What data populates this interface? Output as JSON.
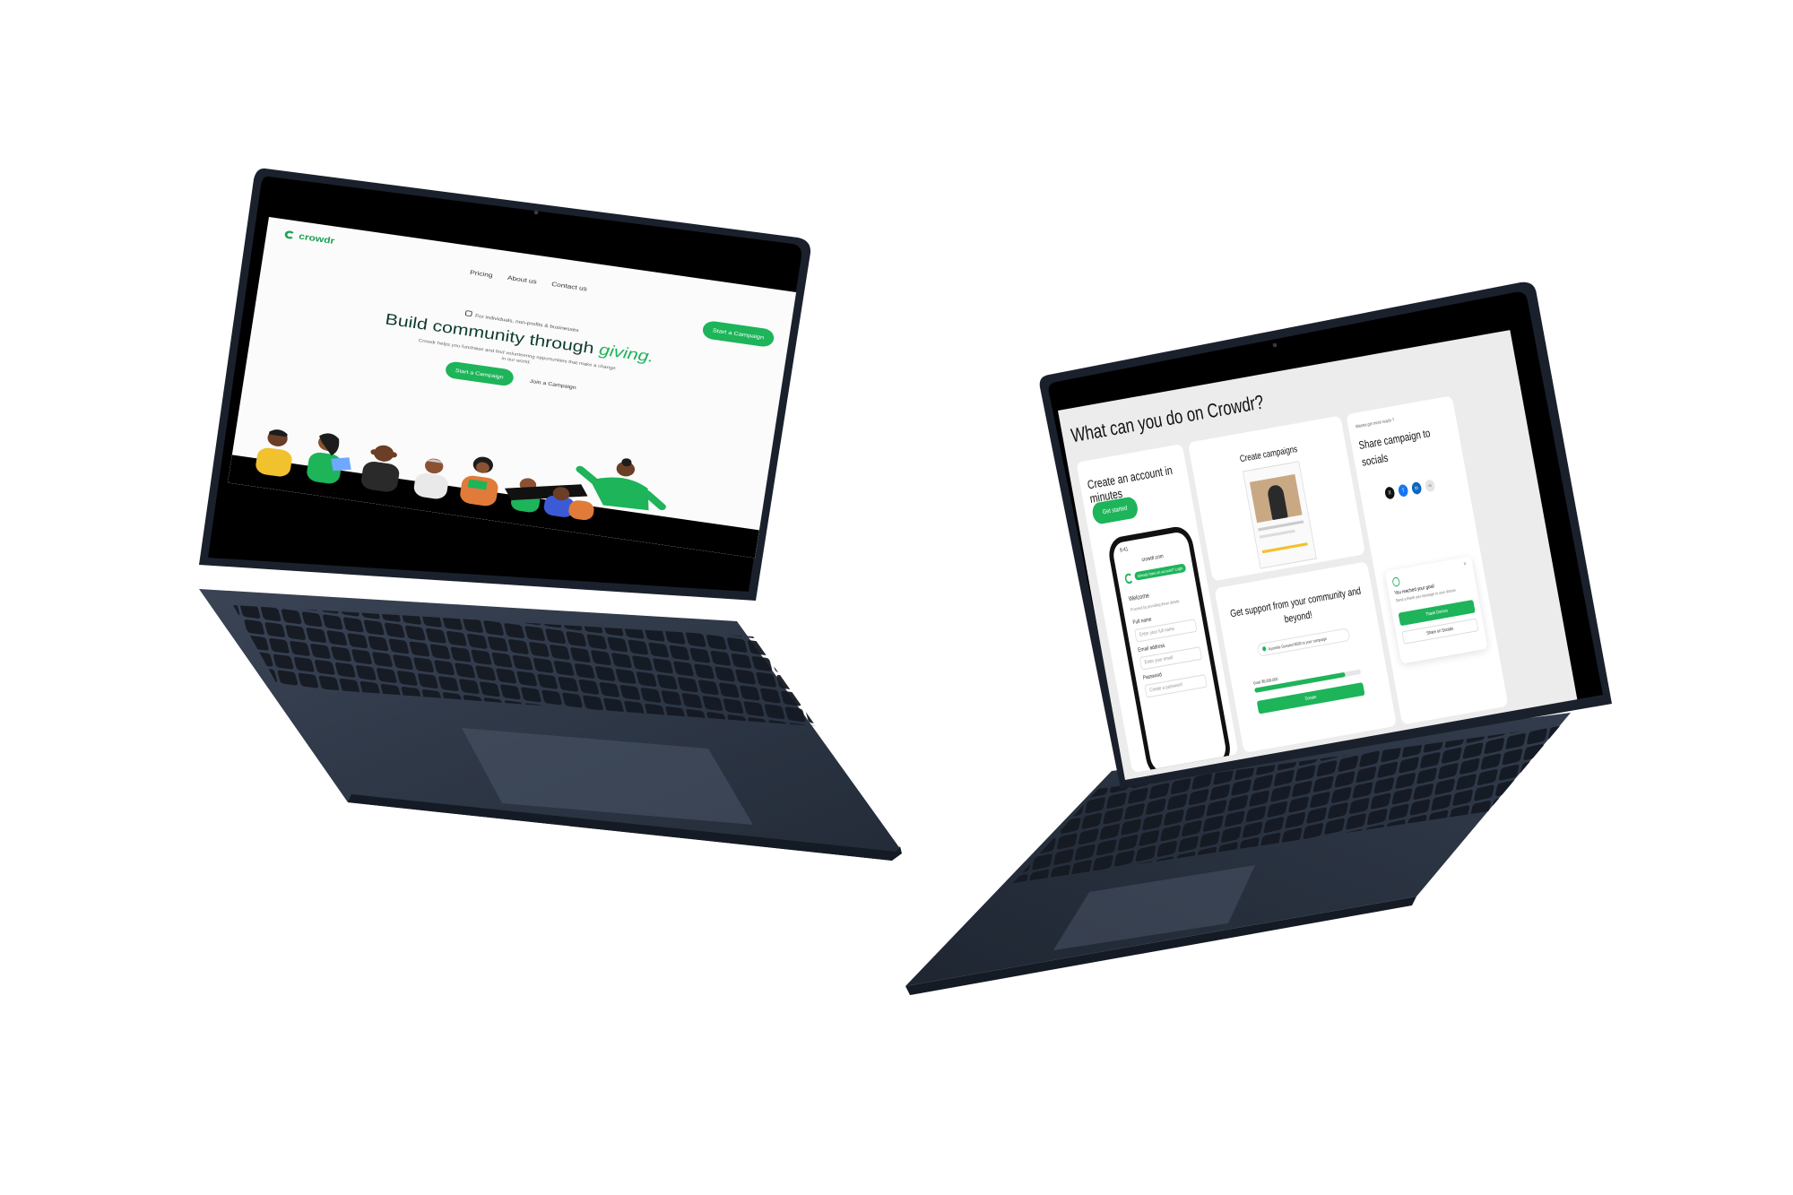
{
  "laptop1": {
    "brand": "crowdr",
    "nav": [
      "Pricing",
      "About us",
      "Contact us"
    ],
    "cta_top": "Start a Campaign",
    "tagline": "For individuals, non-profits & businesses",
    "headline_main": "Build community through ",
    "headline_accent": "giving.",
    "subtext": "Crowdr helps you fundraise and find volunteering opportunities that make a change in our world.",
    "primary_button": "Start a Campaign",
    "secondary_button": "Join a Campaign"
  },
  "laptop2": {
    "page_title": "What can you do on Crowdr?",
    "card_account": {
      "title": "Create an account in minutes",
      "button": "Get started",
      "phone": {
        "time": "9:41",
        "url": "crowdr.com",
        "notice": "Already have an account? Login",
        "welcome": "Welcome",
        "prompt": "Proceed by providing these details",
        "full_name_label": "Full name",
        "full_name_placeholder": "Enter your full name",
        "email_label": "Email address",
        "email_placeholder": "Enter your email",
        "password_label": "Password",
        "password_placeholder": "Create a password"
      }
    },
    "card_create": {
      "title": "Create campaigns"
    },
    "card_support": {
      "title": "Get support from your community and beyond!",
      "notification": "Ayomide Donated $500 to your campaign",
      "progress_label": "Goal: $5,000,000",
      "progress_fraction": 0.85,
      "button": "Donate"
    },
    "card_share": {
      "eyebrow": "Wanna get more reach ?",
      "title": "Share campaign to socials",
      "icons": [
        "x-icon",
        "facebook-icon",
        "linkedin-icon",
        "link-icon"
      ],
      "popup_title": "You reached your goal!",
      "popup_text": "Send a thank you message to your donors",
      "popup_primary": "Thank Donors",
      "popup_secondary": "Share on Socials"
    }
  },
  "colors": {
    "brand_green": "#1db45a",
    "laptop_body": "#2a3342",
    "bezel": "#000000"
  }
}
